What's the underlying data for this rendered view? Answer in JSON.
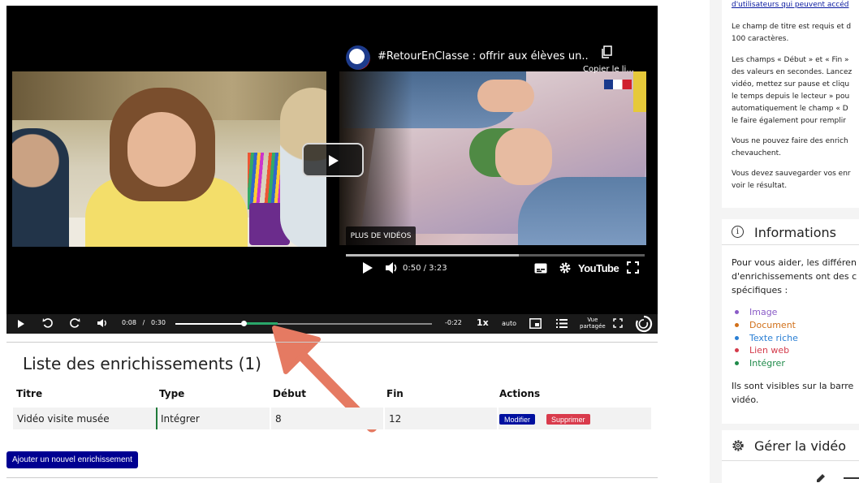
{
  "video": {
    "title": "#RetourEnClasse : offrir aux élèves un...",
    "copy_link_label": "Copier le li...",
    "more_videos": "PLUS DE VIDÉOS",
    "yt_time": "0:50 / 3:23",
    "yt_progress": 0.58,
    "yt_logo": "YouTube"
  },
  "player": {
    "current_time": "0:08",
    "separator": "/",
    "duration": "0:30",
    "remaining": "-0:22",
    "progress": 0.267,
    "enrichment_marker": {
      "start": 8,
      "end": 12,
      "total": 30
    },
    "speed": "1x",
    "quality": "auto",
    "shared_view_line1": "Vue",
    "shared_view_line2": "partagée"
  },
  "list": {
    "title": "Liste des enrichissements (1)",
    "columns": [
      "Titre",
      "Type",
      "Début",
      "Fin",
      "Actions"
    ],
    "rows": [
      {
        "title": "Vidéo visite musée",
        "type": "Intégrer",
        "start": "8",
        "end": "12"
      }
    ],
    "modify_label": "Modifier",
    "delete_label": "Supprimer",
    "add_label": "Ajouter un nouvel enrichissement"
  },
  "sidebar": {
    "help_link": "d'utilisateurs qui peuvent accéd",
    "help_paragraphs": [
      [
        "Le champ de titre est requis et d",
        "100 caractères."
      ],
      [
        "Les champs « Début » et « Fin »",
        "des valeurs en secondes. Lancez",
        "vidéo, mettez sur pause et cliqu",
        "le temps depuis le lecteur » pou",
        "automatiquement le champ « D",
        "le faire également pour remplir"
      ],
      [
        "Vous ne pouvez faire des enrich",
        "chevauchent."
      ],
      [
        "Vous devez sauvegarder vos enr",
        "voir le résultat."
      ]
    ],
    "info_title": "Informations",
    "info_intro": [
      "Pour vous aider, les différen",
      "d'enrichissements ont des c",
      "spécifiques :"
    ],
    "legend": [
      {
        "label": "Image",
        "color": "#8a5cc7"
      },
      {
        "label": "Document",
        "color": "#d1701a"
      },
      {
        "label": "Texte riche",
        "color": "#2b7fd4"
      },
      {
        "label": "Lien web",
        "color": "#d43b4b"
      },
      {
        "label": "Intégrer",
        "color": "#1f8a4a"
      }
    ],
    "info_outro": [
      "Ils sont visibles sur la barre",
      "vidéo."
    ],
    "manage_title": "Gérer la vidéo"
  }
}
